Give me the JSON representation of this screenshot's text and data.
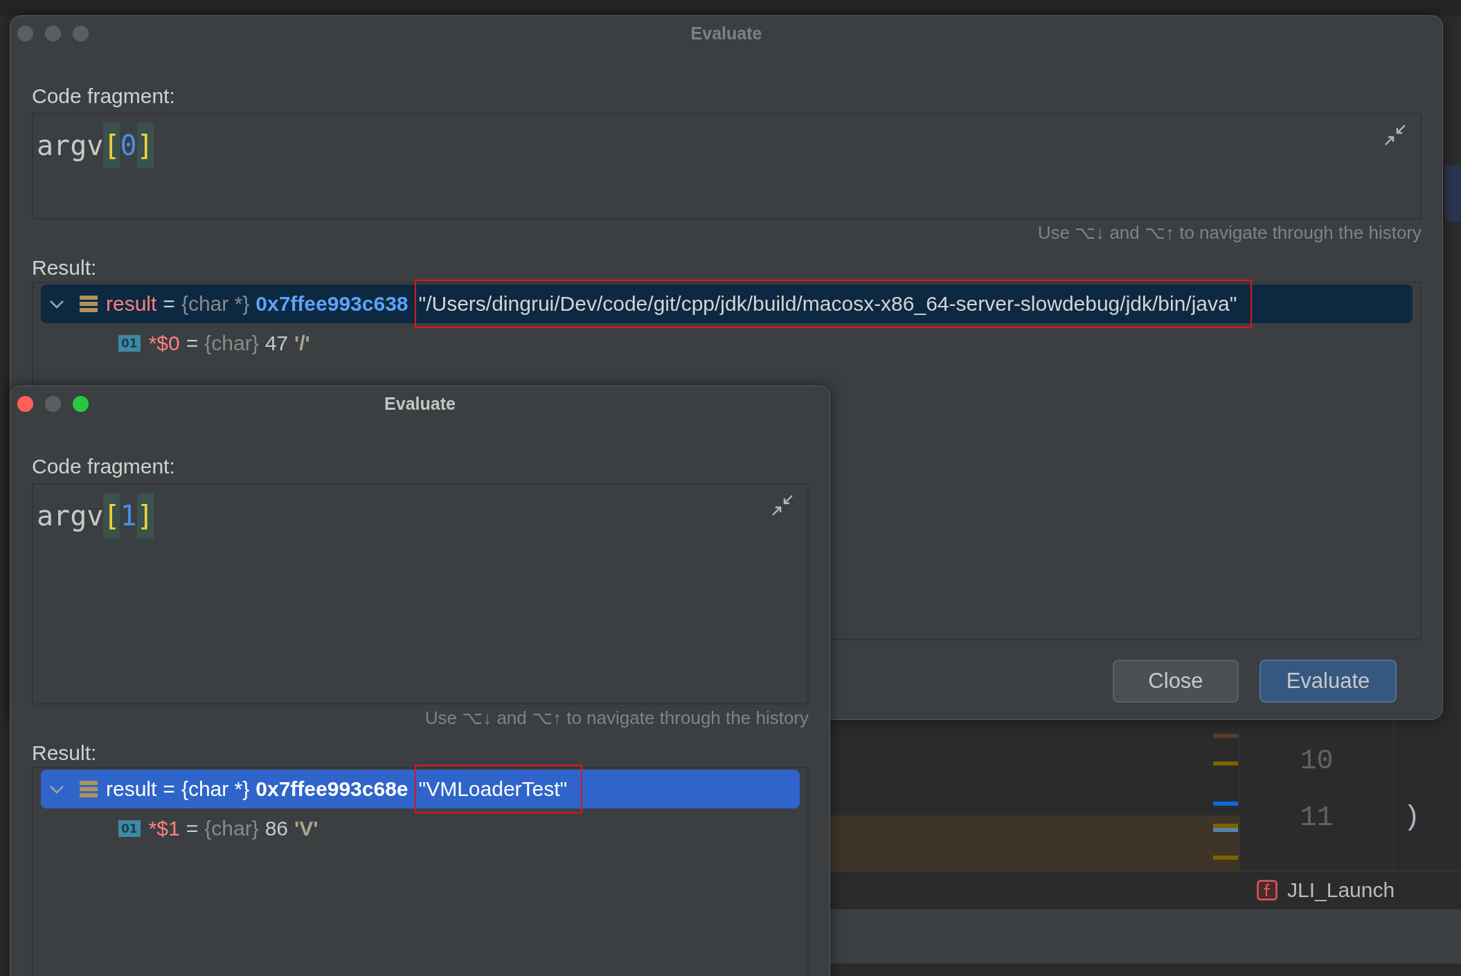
{
  "dialogs": [
    {
      "title": "Evaluate",
      "active": false,
      "traffic_lights": [
        {
          "color": "#5b5d60"
        },
        {
          "color": "#5b5d60"
        },
        {
          "color": "#5b5d60"
        }
      ],
      "code_label": "Code fragment:",
      "code": {
        "name": "argv",
        "open": "[",
        "index": "0",
        "close": "]"
      },
      "hint": "Use ⌥↓ and ⌥↑ to navigate through the history",
      "result_label": "Result:",
      "result": {
        "expanded": true,
        "selected": true,
        "focused": false,
        "name": "result",
        "eq": "=",
        "type": "{char *}",
        "address": "0x7ffee993c638",
        "value": "\"/Users/dingrui/Dev/code/git/cpp/jdk/build/macosx-x86_64-server-slowdebug/jdk/bin/java\"",
        "highlighted": true
      },
      "child": {
        "badge": "01",
        "name": "*$0",
        "eq": "=",
        "type": "{char}",
        "value": "47",
        "char": "'/'"
      },
      "buttons": [
        {
          "label": "Close",
          "kind": "secondary"
        },
        {
          "label": "Evaluate",
          "kind": "primary"
        }
      ]
    },
    {
      "title": "Evaluate",
      "active": true,
      "traffic_lights": [
        {
          "color": "#fe5f57"
        },
        {
          "color": "#5b5d60"
        },
        {
          "color": "#28c840"
        }
      ],
      "code_label": "Code fragment:",
      "code": {
        "name": "argv",
        "open": "[",
        "index": "1",
        "close": "]"
      },
      "hint": "Use ⌥↓ and ⌥↑ to navigate through the history",
      "result_label": "Result:",
      "result": {
        "expanded": true,
        "selected": true,
        "focused": true,
        "name": "result",
        "eq": "=",
        "type": "{char *}",
        "address": "0x7ffee993c68e",
        "value": "\"VMLoaderTest\"",
        "highlighted": true
      },
      "child": {
        "badge": "01",
        "name": "*$1",
        "eq": "=",
        "type": "{char}",
        "value": "86",
        "char": "'V'"
      }
    }
  ],
  "editor": {
    "line_numbers": [
      "10",
      "11"
    ],
    "code_lines": [
      ")"
    ],
    "breadcrumb": "JLI_Launch"
  }
}
